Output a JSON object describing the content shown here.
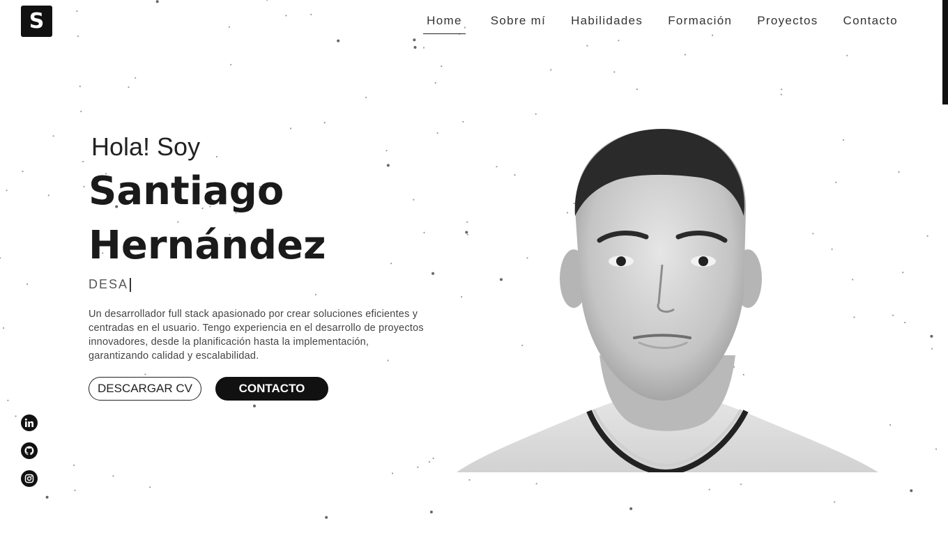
{
  "brand": {
    "logo_letter": "S"
  },
  "nav": {
    "items": [
      {
        "label": "Home",
        "active": true
      },
      {
        "label": "Sobre mí",
        "active": false
      },
      {
        "label": "Habilidades",
        "active": false
      },
      {
        "label": "Formación",
        "active": false
      },
      {
        "label": "Proyectos",
        "active": false
      },
      {
        "label": "Contacto",
        "active": false
      }
    ]
  },
  "hero": {
    "greeting": "Hola! Soy",
    "name_first": "Santiago",
    "name_last": "Hernández",
    "role_typed": "DESA",
    "bio": "Un desarrollador full stack apasionado por crear soluciones eficientes y centradas en el usuario. Tengo experiencia en el desarrollo de proyectos innovadores, desde la planificación hasta la implementación, garantizando calidad y escalabilidad.",
    "buttons": {
      "cv": "DESCARGAR CV",
      "contact": "CONTACTO"
    }
  },
  "social": [
    {
      "icon": "linkedin-icon"
    },
    {
      "icon": "github-icon"
    },
    {
      "icon": "instagram-icon"
    }
  ],
  "colors": {
    "accent": "#111111",
    "background": "#ffffff",
    "text": "#1a1a1a"
  }
}
